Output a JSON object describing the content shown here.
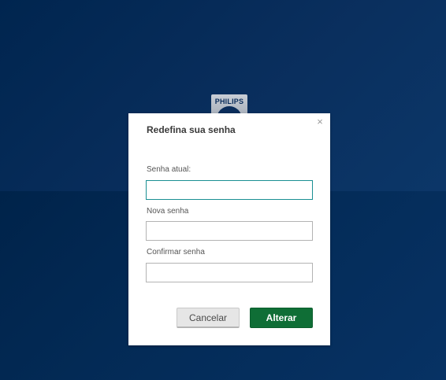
{
  "brand": {
    "logo_text": "PHILIPS"
  },
  "dialog": {
    "title": "Redefina sua senha",
    "close_glyph": "×",
    "fields": [
      {
        "label": "Senha atual:",
        "value": ""
      },
      {
        "label": "Nova senha",
        "value": ""
      },
      {
        "label": "Confirmar senha",
        "value": ""
      }
    ],
    "cancel_label": "Cancelar",
    "submit_label": "Alterar"
  },
  "colors": {
    "background": "#0a2f5e",
    "submit_button": "#0f6e36",
    "focus_border": "#1a8f93"
  },
  "icons": {
    "close": "close-icon",
    "logo": "philips-shield-logo"
  }
}
